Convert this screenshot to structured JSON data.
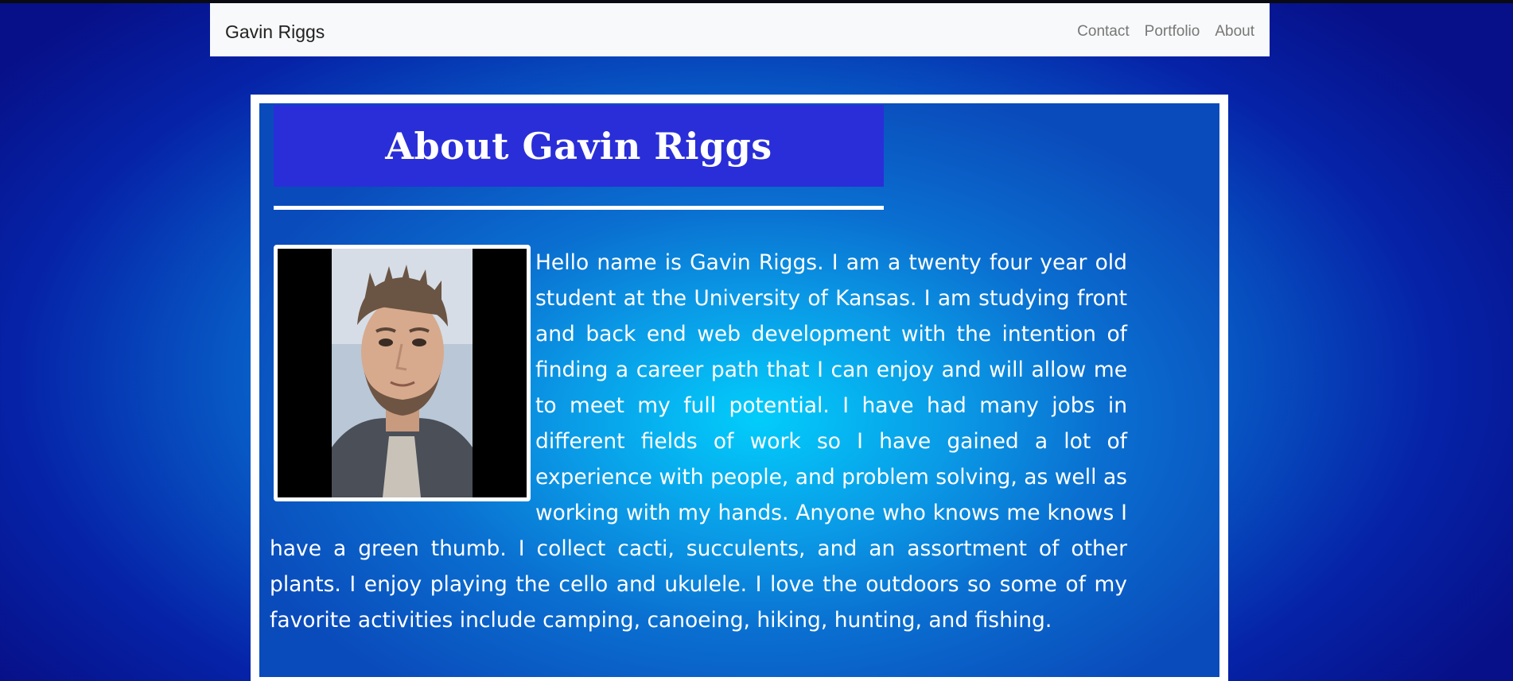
{
  "navbar": {
    "brand": "Gavin Riggs",
    "links": [
      {
        "label": "Contact"
      },
      {
        "label": "Portfolio"
      },
      {
        "label": "About"
      }
    ]
  },
  "main": {
    "title": "About Gavin Riggs",
    "photo_alt": "portrait-photo",
    "bio": "Hello name is Gavin Riggs. I am a twenty four year old student at the University of Kansas. I am studying front and back end web development with the intention of finding a career path that I can enjoy and will allow me to meet my full potential. I have had many jobs in different fields of work so I have gained a lot of experience with people, and problem solving, as well as working with my hands. Anyone who knows me knows I have a green thumb. I collect cacti, succulents, and an assortment of other plants. I enjoy playing the cello and ukulele. I love the outdoors so some of my favorite activities include camping, canoeing, hiking, hunting, and fishing."
  },
  "colors": {
    "navbar_bg": "#f8f9fa",
    "title_box": "#2a2ed8",
    "page_bg_center": "#00d4ff",
    "page_bg_edge": "#071088",
    "text": "#ffffff"
  }
}
